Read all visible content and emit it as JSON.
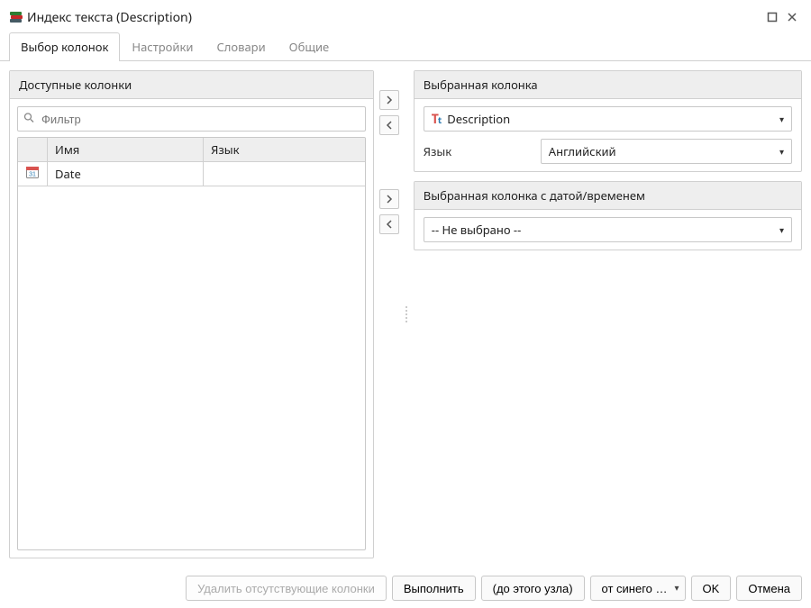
{
  "window": {
    "title": "Индекс текста (Description)"
  },
  "tabs": [
    {
      "label": "Выбор колонок",
      "active": true
    },
    {
      "label": "Настройки",
      "active": false
    },
    {
      "label": "Словари",
      "active": false
    },
    {
      "label": "Общие",
      "active": false
    }
  ],
  "left": {
    "header": "Доступные колонки",
    "filter_placeholder": "Фильтр",
    "columns": {
      "icon": "",
      "name": "Имя",
      "lang": "Язык"
    },
    "rows": [
      {
        "icon": "calendar",
        "name": "Date",
        "lang": ""
      }
    ]
  },
  "right": {
    "selected": {
      "header": "Выбранная колонка",
      "value": "Description",
      "lang_label": "Язык",
      "lang_value": "Английский"
    },
    "datetime": {
      "header": "Выбранная колонка с датой/временем",
      "value": "-- Не выбрано --"
    }
  },
  "footer": {
    "remove_missing": "Удалить отсутствующие колонки",
    "execute": "Выполнить",
    "until_node": "(до этого узла)",
    "scope": "от синего …",
    "ok": "OK",
    "cancel": "Отмена"
  }
}
